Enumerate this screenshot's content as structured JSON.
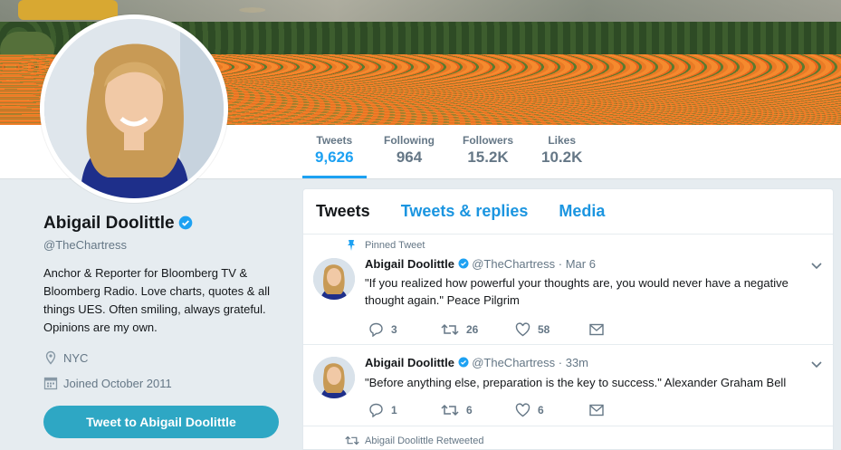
{
  "stats": [
    {
      "label": "Tweets",
      "value": "9,626",
      "active": true
    },
    {
      "label": "Following",
      "value": "964"
    },
    {
      "label": "Followers",
      "value": "15.2K"
    },
    {
      "label": "Likes",
      "value": "10.2K"
    }
  ],
  "profile": {
    "name": "Abigail Doolittle",
    "handle": "@TheChartress",
    "bio": "Anchor & Reporter for Bloomberg TV & Bloomberg Radio. Love charts, quotes & all things UES. Often smiling, always grateful. Opinions are my own.",
    "location": "NYC",
    "joined": "Joined October 2011",
    "tweet_to_label": "Tweet to Abigail Doolittle"
  },
  "tabs": [
    "Tweets",
    "Tweets & replies",
    "Media"
  ],
  "tweets": [
    {
      "context": "Pinned Tweet",
      "name": "Abigail Doolittle",
      "handle": "@TheChartress",
      "time": "· Mar 6",
      "text": "\"If you realized how powerful your thoughts are, you would never have a negative thought again.\"  Peace Pilgrim",
      "replies": "3",
      "retweets": "26",
      "likes": "58"
    },
    {
      "name": "Abigail Doolittle",
      "handle": "@TheChartress",
      "time": "· 33m",
      "text": "\"Before anything else, preparation is the key to success.\"  Alexander Graham Bell",
      "replies": "1",
      "retweets": "6",
      "likes": "6"
    }
  ],
  "retweeted_context": "Abigail Doolittle Retweeted",
  "colors": {
    "accent": "#1da1f2",
    "tab_link": "#1b95e0",
    "button": "#2ea7c4",
    "page_bg": "#e6ecf0"
  }
}
